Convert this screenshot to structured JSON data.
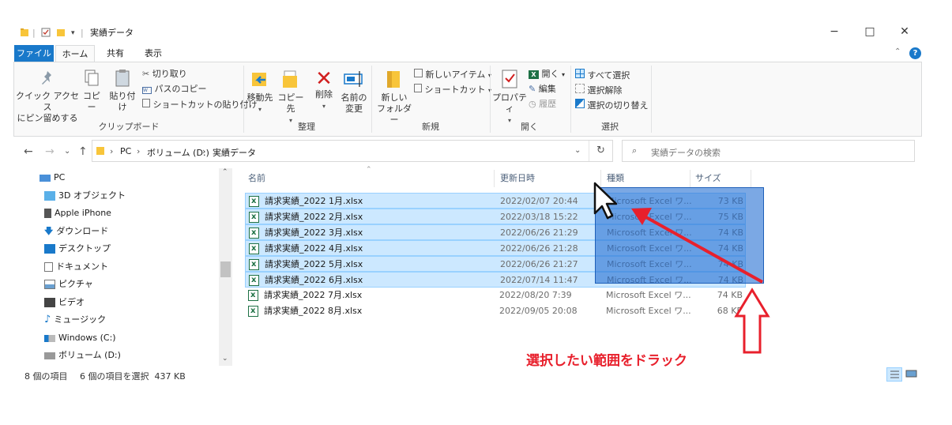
{
  "window": {
    "title": "実績データ",
    "controls": {
      "minimize": "−",
      "maximize": "□",
      "close": "✕"
    }
  },
  "ribbon_tabs": [
    {
      "label": "ファイル"
    },
    {
      "label": "ホーム"
    },
    {
      "label": "共有"
    },
    {
      "label": "表示"
    }
  ],
  "ribbon": {
    "clipboard": {
      "pin_label_1": "クイック アクセス",
      "pin_label_2": "にピン留めする",
      "copy": "コピー",
      "paste": "貼り付け",
      "cut": "切り取り",
      "copy_path": "パスのコピー",
      "paste_shortcut": "ショートカットの貼り付け",
      "group": "クリップボード"
    },
    "organize": {
      "move_to": "移動先",
      "copy_to": "コピー先",
      "delete": "削除",
      "rename_1": "名前の",
      "rename_2": "変更",
      "group": "整理"
    },
    "new": {
      "new_folder_1": "新しい",
      "new_folder_2": "フォルダー",
      "new_item": "新しいアイテム",
      "shortcut": "ショートカット",
      "group": "新規"
    },
    "open": {
      "properties": "プロパティ",
      "open": "開く",
      "edit": "編集",
      "history": "履歴",
      "group": "開く"
    },
    "select": {
      "select_all": "すべて選択",
      "select_none": "選択解除",
      "invert": "選択の切り替え",
      "group": "選択"
    }
  },
  "address": {
    "crumbs": [
      "PC",
      "ボリューム (D:)",
      "実績データ"
    ],
    "search_placeholder": "実績データの検索"
  },
  "nav_pane": [
    {
      "label": "PC",
      "icon": "pc-icon"
    },
    {
      "label": "3D オブジェクト",
      "icon": "3d-objects-icon"
    },
    {
      "label": "Apple iPhone",
      "icon": "phone-icon"
    },
    {
      "label": "ダウンロード",
      "icon": "download-icon"
    },
    {
      "label": "デスクトップ",
      "icon": "desktop-icon"
    },
    {
      "label": "ドキュメント",
      "icon": "document-icon"
    },
    {
      "label": "ピクチャ",
      "icon": "pictures-icon"
    },
    {
      "label": "ビデオ",
      "icon": "video-icon"
    },
    {
      "label": "ミュージック",
      "icon": "music-icon"
    },
    {
      "label": "Windows (C:)",
      "icon": "drive-c-icon"
    },
    {
      "label": "ボリューム (D:)",
      "icon": "drive-d-icon"
    }
  ],
  "columns": {
    "name": "名前",
    "date": "更新日時",
    "type": "種類",
    "size": "サイズ"
  },
  "files": [
    {
      "name": "請求実績_2022 1月.xlsx",
      "date": "2022/02/07 20:44",
      "type": "Microsoft Excel ワ...",
      "size": "73 KB",
      "selected": true
    },
    {
      "name": "請求実績_2022 2月.xlsx",
      "date": "2022/03/18 15:22",
      "type": "Microsoft Excel ワ...",
      "size": "75 KB",
      "selected": true
    },
    {
      "name": "請求実績_2022 3月.xlsx",
      "date": "2022/06/26 21:29",
      "type": "Microsoft Excel ワ...",
      "size": "74 KB",
      "selected": true
    },
    {
      "name": "請求実績_2022 4月.xlsx",
      "date": "2022/06/26 21:28",
      "type": "Microsoft Excel ワ...",
      "size": "74 KB",
      "selected": true
    },
    {
      "name": "請求実績_2022 5月.xlsx",
      "date": "2022/06/26 21:27",
      "type": "Microsoft Excel ワ...",
      "size": "74 KB",
      "selected": true
    },
    {
      "name": "請求実績_2022 6月.xlsx",
      "date": "2022/07/14 11:47",
      "type": "Microsoft Excel ワ...",
      "size": "74 KB",
      "selected": true
    },
    {
      "name": "請求実績_2022 7月.xlsx",
      "date": "2022/08/20 7:39",
      "type": "Microsoft Excel ワ...",
      "size": "74 KB",
      "selected": false
    },
    {
      "name": "請求実績_2022 8月.xlsx",
      "date": "2022/09/05 20:08",
      "type": "Microsoft Excel ワ...",
      "size": "68 KB",
      "selected": false
    }
  ],
  "status": {
    "item_count": "8 個の項目",
    "selection": "6 個の項目を選択  437 KB"
  },
  "annotation": {
    "text": "選択したい範囲をドラック",
    "color": "#e8202c"
  },
  "colors": {
    "accent": "#1979ca",
    "selection": "#cce8ff",
    "drag_rect": "#236ed2"
  }
}
